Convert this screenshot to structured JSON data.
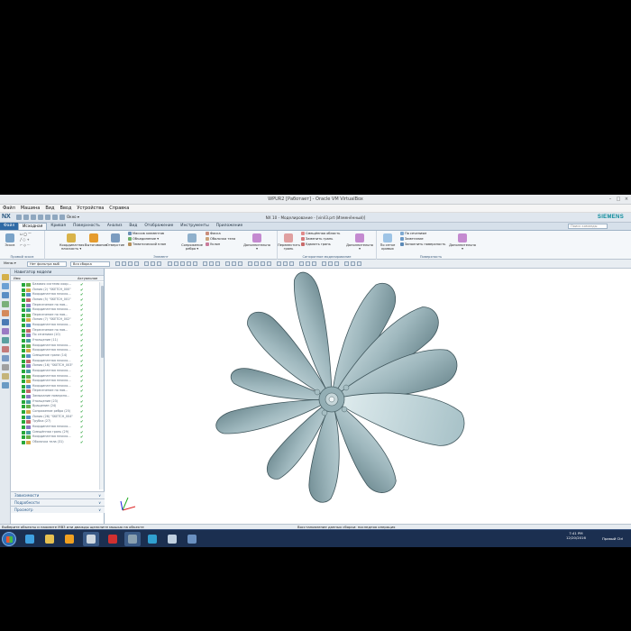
{
  "vbox": {
    "title": "WPUR2 [Работает] - Oracle VM VirtualBox",
    "menu": [
      "Файл",
      "Машина",
      "Вид",
      "Ввод",
      "Устройства",
      "Справка"
    ]
  },
  "nx": {
    "logo": "NX",
    "qat_label": "Окно ▾",
    "title": "NX 10 - Моделирование - [vinil3.prt (Изменённый)]",
    "brand": "SIEMENS",
    "command_search_placeholder": "Поиск команды",
    "tabs": [
      "Файл",
      "Исходная",
      "Кривая",
      "Поверхность",
      "Анализ",
      "Вид",
      "Отображение",
      "Инструменты",
      "Приложение"
    ],
    "active_tab": "Исходная"
  },
  "ribbon": {
    "groups": [
      {
        "label": "Прямой эскиз",
        "buttons": [
          "Эскиз"
        ]
      },
      {
        "label": "Элемент",
        "buttons": [
          "Координатная плоскость ▾",
          "Вытягивание",
          "Отверстие",
          "Сопряжение ребра ▾"
        ],
        "small": [
          "Массив элементов",
          "Объединение ▾",
          "Тематический план",
          "Фаска",
          "Оболочка тела",
          "Уклон",
          "Дополнительно ▾"
        ]
      },
      {
        "label": "Синхронное моделирование",
        "buttons": [
          "Переместить грань"
        ],
        "small": [
          "Смещённая область",
          "Заменить грань",
          "Удалить грань",
          "Дополнительно ▾"
        ]
      },
      {
        "label": "Поверхность",
        "buttons": [
          "По сетке кривых"
        ],
        "small": [
          "По сечениям",
          "Заметание",
          "Заполнить поверхность",
          "Дополнительно ▾"
        ]
      }
    ]
  },
  "selection_bar": {
    "menu_label": "Меню ▾",
    "filter": "Нет фильтра выб",
    "scope": "Вся сборка"
  },
  "navigator": {
    "title": "Навигатор модели",
    "col_name": "Имя",
    "col_updated": "Актуальное",
    "rows": [
      "Базовая система коор...",
      "Линия (2) \"SKETCH_000\"",
      "Координатная плоско...",
      "Линия (5) \"SKETCH_001\"",
      "Пересечение по пов...",
      "Координатная плоско...",
      "Пересечение по пов...",
      "Линия (7) \"SKETCH_002\"",
      "Координатная плоско...",
      "Пересечение по пов...",
      "По сечениям (10)",
      "Утолщение (11)",
      "Координатная плоско...",
      "Координатная плоско...",
      "Смещение грани (14)",
      "Координатная плоско...",
      "Линия (16) \"SKETCH_003\"",
      "Координатная плоско...",
      "Координатная плоско...",
      "Координатная плоско...",
      "Координатная плоско...",
      "Пересечение по пов...",
      "Замыкание поверхно...",
      "Утолщение (23)",
      "Вращение (24)",
      "Сопряжение ребра (25)",
      "Линия (26) \"SKETCH_004\"",
      "Трубка (27)",
      "Координатная плоско...",
      "Смещённая грань (29)",
      "Координатная плоско...",
      "Оболочка тела (31)"
    ],
    "panels": [
      "Зависимости",
      "Подробности",
      "Просмотр"
    ]
  },
  "status": {
    "left": "Выберите объекты и нажмите MB3 или дважды щелкните мышью на объекте",
    "right": "Восстановление данных сборки: последняя операция"
  },
  "taskbar": {
    "time": "7:41 PM",
    "date": "12/20/2016",
    "keyboard": "Правый Ctrl"
  },
  "colors": {
    "accent": "#2f6aa5",
    "part_body": "#a9c1c7",
    "ok_green": "#20a030"
  }
}
